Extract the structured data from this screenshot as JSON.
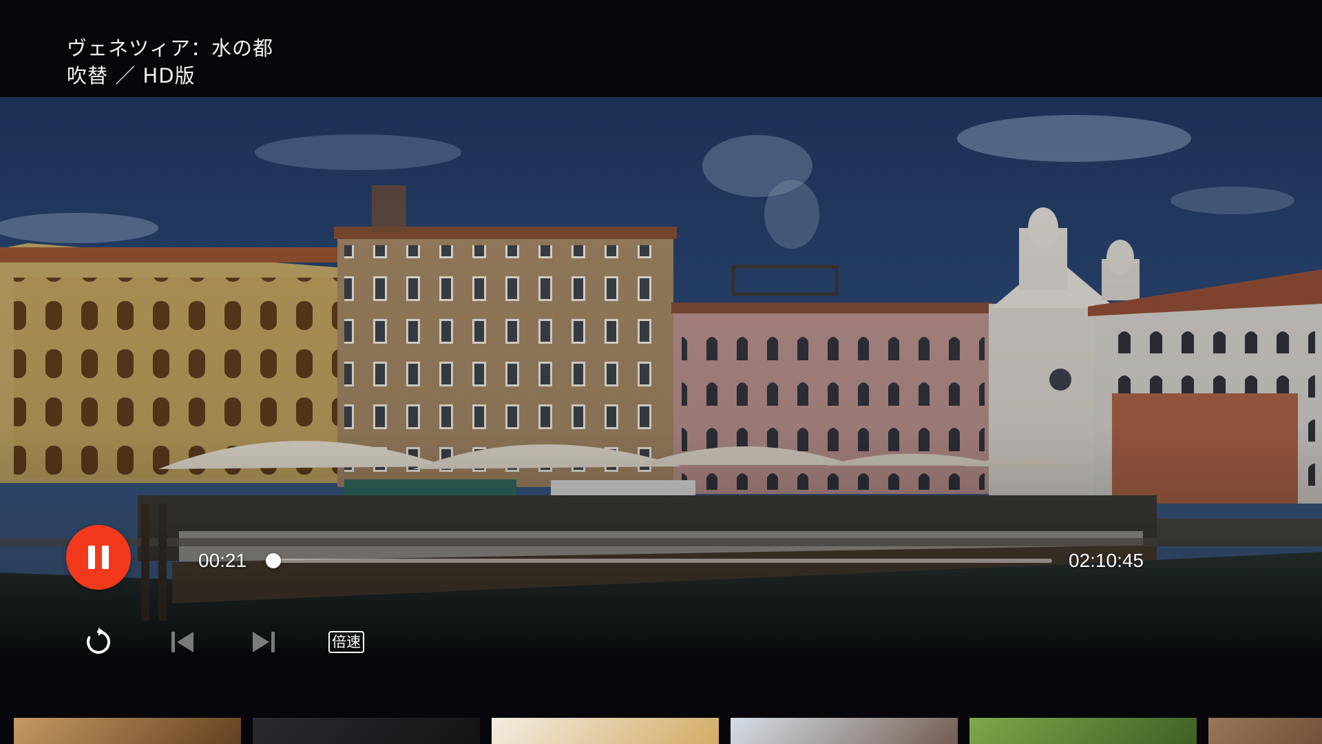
{
  "video": {
    "title": "ヴェネツィア：水の都",
    "subtitle": "吹替 ／ HD版"
  },
  "player": {
    "state": "playing",
    "current_time": "00:21",
    "total_time": "02:10:45",
    "progress_fraction": 0.0027,
    "speed_label": "倍速",
    "accent_color": "#f2391c"
  },
  "controls": {
    "icons": [
      "pause-icon",
      "replay-icon",
      "skip-previous-icon",
      "skip-next-icon",
      "speed-icon"
    ]
  },
  "thumbnails": [
    {
      "name": "thumbnail-1",
      "colors": [
        "#c49a63",
        "#5d3a1c"
      ]
    },
    {
      "name": "thumbnail-2",
      "colors": [
        "#2a2b2f",
        "#111214"
      ]
    },
    {
      "name": "thumbnail-3",
      "colors": [
        "#f3ede3",
        "#d1a75c"
      ]
    },
    {
      "name": "thumbnail-4",
      "colors": [
        "#d6dfe9",
        "#6d5548"
      ]
    },
    {
      "name": "thumbnail-5",
      "colors": [
        "#7ea84a",
        "#3c5a22"
      ]
    },
    {
      "name": "thumbnail-6",
      "colors": [
        "#9b7658",
        "#4a3020"
      ]
    }
  ]
}
